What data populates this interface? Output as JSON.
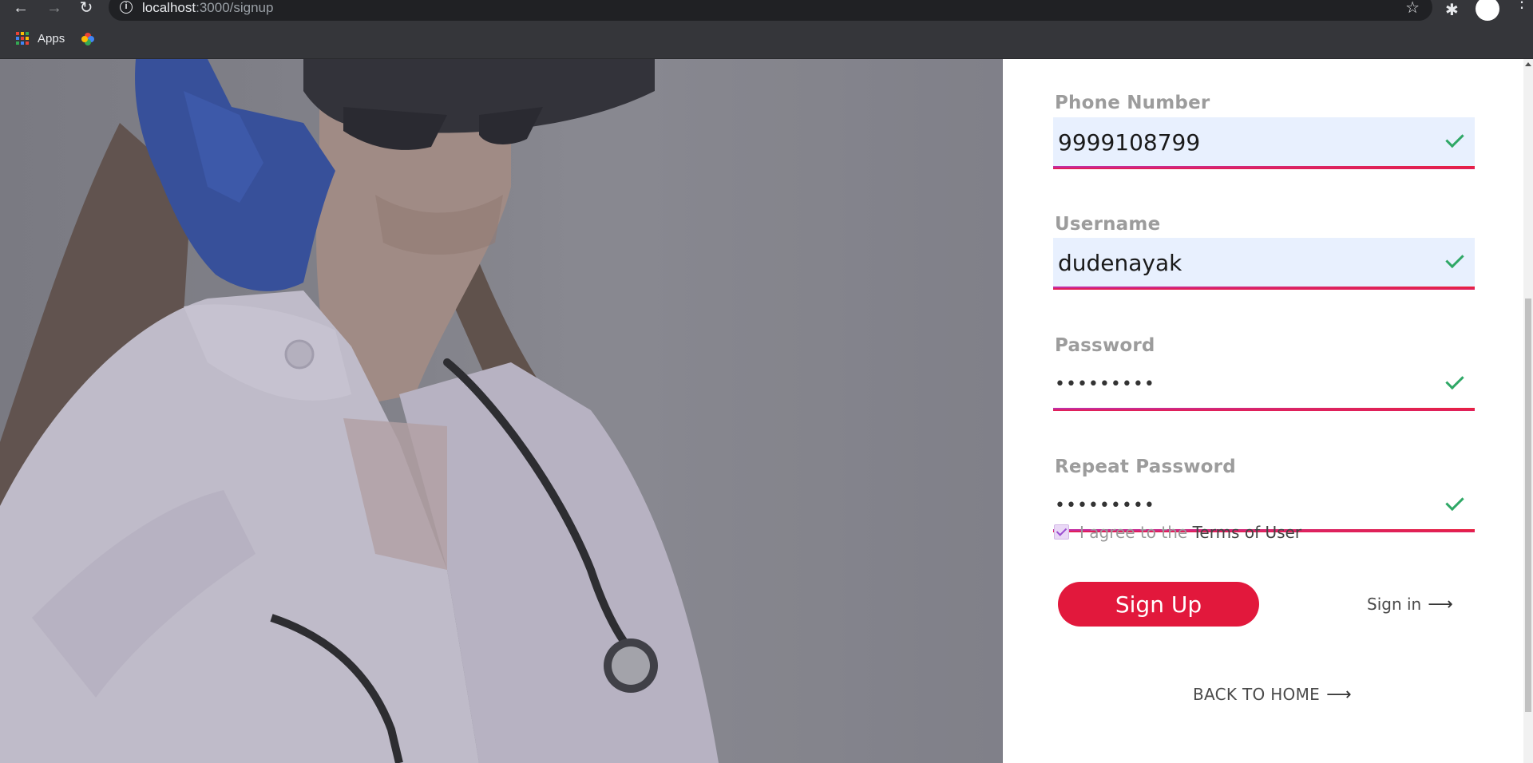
{
  "browser": {
    "url_host": "localhost",
    "url_path": ":3000/signup",
    "bookmarks": {
      "apps_label": "Apps"
    }
  },
  "form": {
    "phone": {
      "label": "Phone Number",
      "value": "9999108799"
    },
    "username": {
      "label": "Username",
      "value": "dudenayak"
    },
    "password": {
      "label": "Password",
      "value": "•••••••••"
    },
    "repeat_password": {
      "label": "Repeat Password",
      "value": "•••••••••"
    },
    "agree": {
      "prefix": "I agree to the ",
      "link": "Terms of User",
      "checked": true
    },
    "signup_label": "Sign Up",
    "signin_label": "Sign in",
    "back_home_label": "BACK TO HOME"
  },
  "colors": {
    "accent": "#e2183c",
    "valid": "#2fa866",
    "autofill_bg": "#e8f0fe"
  }
}
